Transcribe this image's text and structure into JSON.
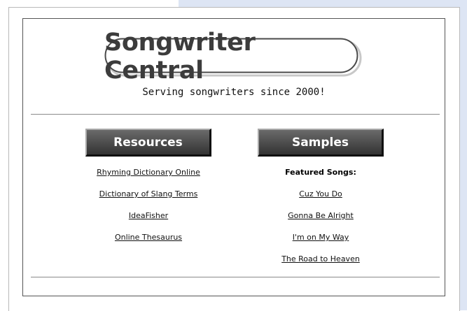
{
  "site": {
    "title": "Songwriter Central",
    "tagline": "Serving songwriters since 2000!"
  },
  "resources": {
    "header_label": "Resources",
    "links": [
      "Rhyming Dictionary Online",
      "Dictionary of Slang Terms",
      "IdeaFisher",
      "Online Thesaurus"
    ]
  },
  "samples": {
    "header_label": "Samples",
    "featured_title": "Featured Songs:",
    "songs": [
      "Cuz You Do",
      "Gonna Be Alright",
      "I'm on My Way",
      "The Road to Heaven"
    ]
  },
  "colors": {
    "page_background": "#ffffff",
    "side_tint": "#dde5f4",
    "button_gray": "#515151",
    "button_text": "#ffffff",
    "logo_text": "#3c3c3c"
  }
}
